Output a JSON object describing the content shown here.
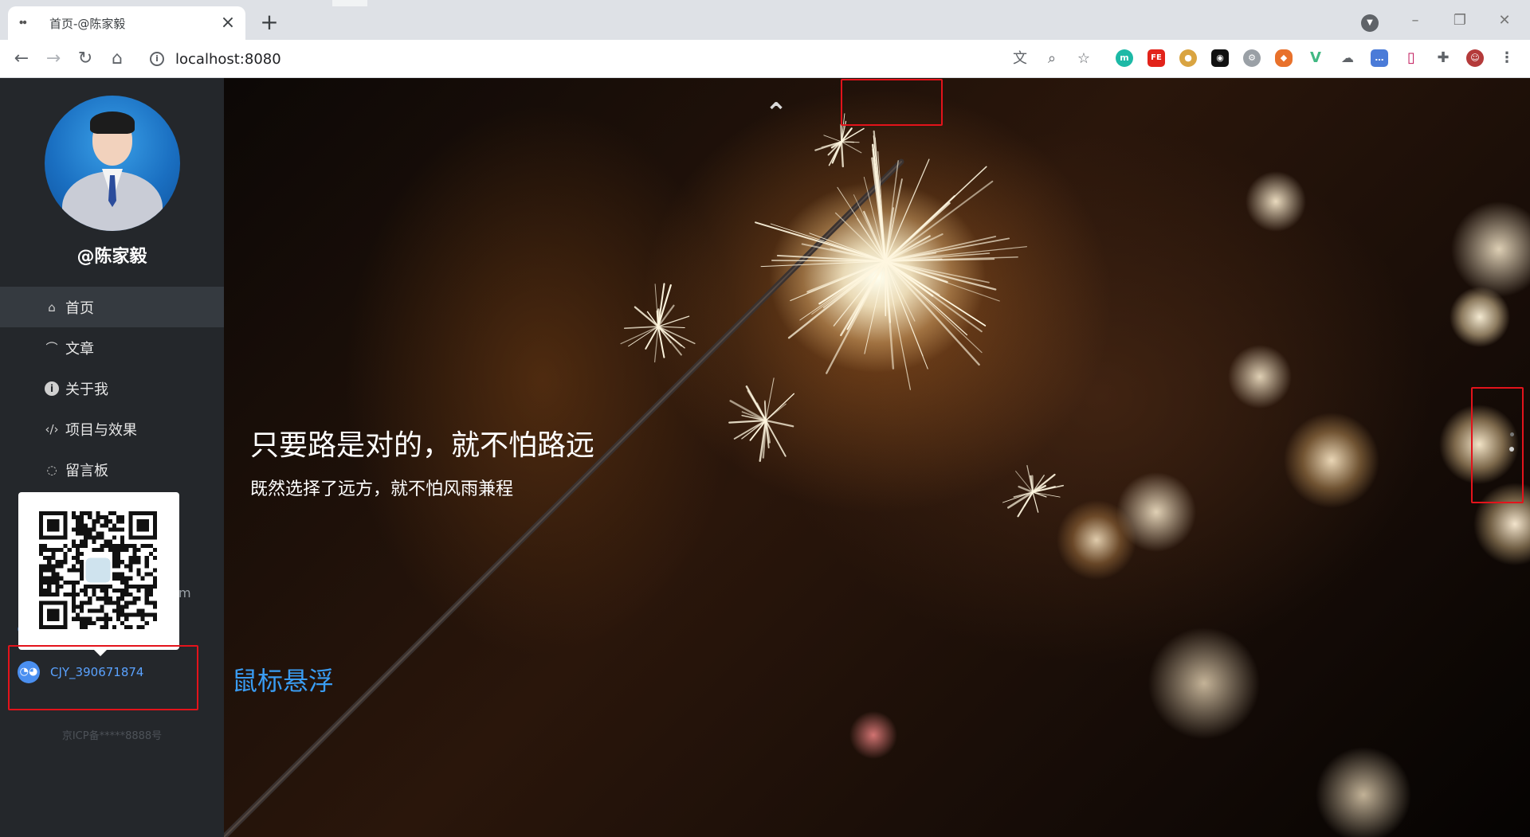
{
  "browser": {
    "tab": {
      "favicon": "ꔷꔷ",
      "title": "首页-@陈家毅"
    },
    "url": "localhost:8080",
    "extensions": [
      "m",
      "FE",
      "cookie-icon",
      "todo-icon",
      "gear-icon",
      "fox-icon",
      "vue-icon",
      "cloud-icon",
      "chat-icon",
      "bookmark-icon",
      "puzzle-icon",
      "profile-avatar"
    ]
  },
  "sidebar": {
    "username": "@陈家毅",
    "menu": [
      {
        "label": "首页",
        "icon": "home-icon"
      },
      {
        "label": "文章",
        "icon": "rss-icon"
      },
      {
        "label": "关于我",
        "icon": "info-icon"
      },
      {
        "label": "项目与效果",
        "icon": "code-icon"
      },
      {
        "label": "留言板",
        "icon": "chat-icon"
      }
    ],
    "obscured_text": "m",
    "wechat_id": "CJY_390671874",
    "icp": "京ICP备*****8888号"
  },
  "hero": {
    "title": "只要路是对的，就不怕路远",
    "subtitle": "既然选择了远方，就不怕风雨兼程",
    "hover_label": "鼠标悬浮"
  },
  "colors": {
    "sidebar_bg": "#24272b",
    "accent_blue": "#3a9cf2",
    "highlight_red": "#e3131b"
  }
}
